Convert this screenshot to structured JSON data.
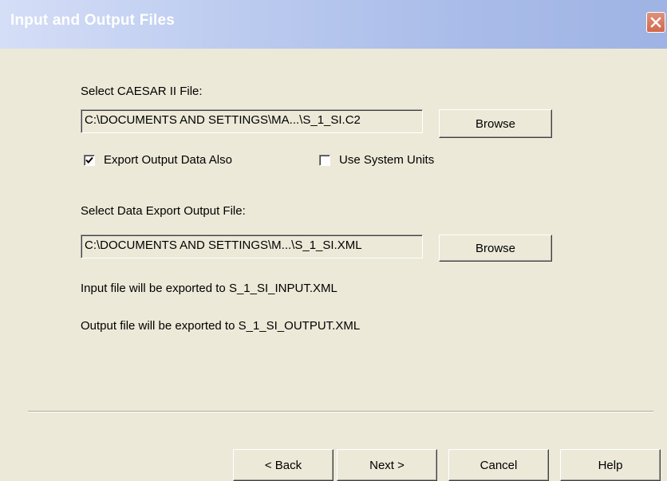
{
  "window": {
    "title": "Input and Output Files",
    "close_icon": "close-icon"
  },
  "caesar_file": {
    "label": "Select CAESAR II File:",
    "path": "C:\\DOCUMENTS AND SETTINGS\\MA...\\S_1_SI.C2",
    "browse_label": "Browse"
  },
  "options": {
    "export_output": {
      "label": "Export Output Data Also",
      "checked": true
    },
    "system_units": {
      "label": "Use System Units",
      "checked": false
    }
  },
  "export_file": {
    "label": "Select Data Export Output File:",
    "path": "C:\\DOCUMENTS AND SETTINGS\\M...\\S_1_SI.XML",
    "browse_label": "Browse"
  },
  "info": {
    "input_message": "Input file will be exported to S_1_SI_INPUT.XML",
    "output_message": "Output file will be exported to S_1_SI_OUTPUT.XML"
  },
  "footer": {
    "back_label": "< Back",
    "next_label": "Next >",
    "cancel_label": "Cancel",
    "help_label": "Help"
  }
}
